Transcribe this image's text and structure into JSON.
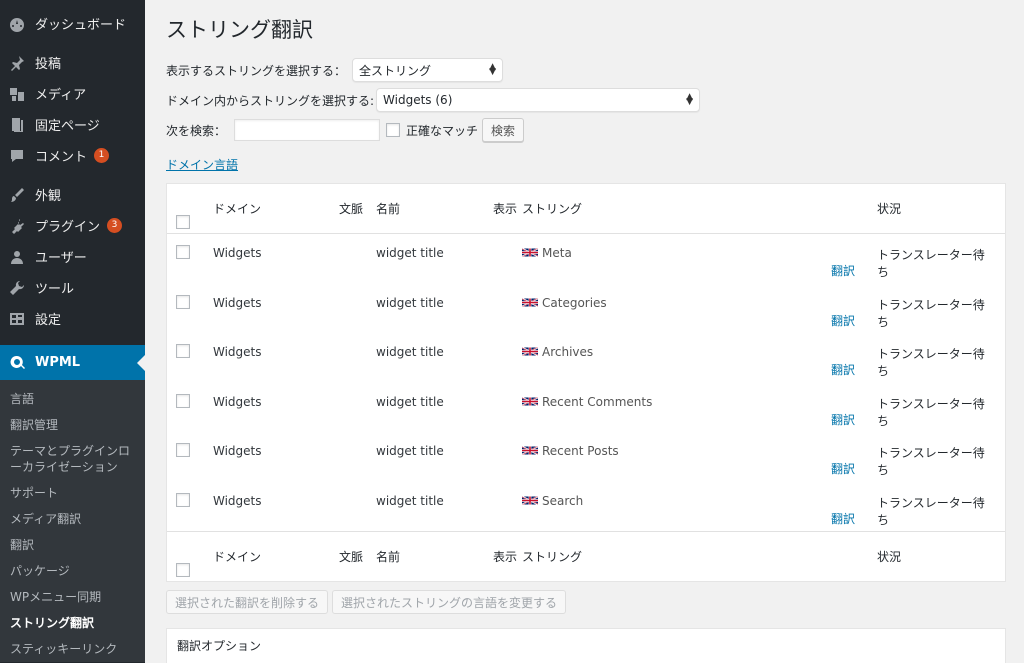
{
  "sidebar": {
    "items": [
      {
        "label": "ダッシュボード",
        "icon": "dashboard-icon"
      },
      {
        "label": "投稿",
        "icon": "pin-icon"
      },
      {
        "label": "メディア",
        "icon": "media-icon"
      },
      {
        "label": "固定ページ",
        "icon": "page-icon"
      },
      {
        "label": "コメント",
        "icon": "comment-icon",
        "badge": "1"
      },
      {
        "label": "外観",
        "icon": "brush-icon"
      },
      {
        "label": "プラグイン",
        "icon": "plugin-icon",
        "badge": "3"
      },
      {
        "label": "ユーザー",
        "icon": "user-icon"
      },
      {
        "label": "ツール",
        "icon": "wrench-icon"
      },
      {
        "label": "設定",
        "icon": "settings-icon"
      }
    ],
    "active": {
      "label": "WPML",
      "icon": "wpml-icon"
    },
    "submenu": [
      "言語",
      "翻訳管理",
      "テーマとプラグインローカライゼーション",
      "サポート",
      "メディア翻訳",
      "翻訳",
      "パッケージ",
      "WPメニュー同期",
      "ストリング翻訳",
      "スティッキーリンク"
    ],
    "submenu_current": "ストリング翻訳"
  },
  "page": {
    "title": "ストリング翻訳",
    "filter1_label": "表示するストリングを選択する：",
    "filter1_value": "全ストリング",
    "filter2_label": "ドメイン内からストリングを選択する:",
    "filter2_value": "Widgets (6)",
    "search_label": "次を検索：",
    "search_value": "",
    "exact_match_label": "正確なマッチ",
    "search_button": "検索",
    "domain_language_link": "ドメイン言語"
  },
  "table": {
    "headers": {
      "domain": "ドメイン",
      "context": "文脈",
      "name": "名前",
      "view": "表示",
      "string": "ストリング",
      "status": "状況"
    },
    "translate_label": "翻訳",
    "rows": [
      {
        "domain": "Widgets",
        "name": "widget title",
        "string": "Meta",
        "status": "トランスレーター待ち"
      },
      {
        "domain": "Widgets",
        "name": "widget title",
        "string": "Categories",
        "status": "トランスレーター待ち"
      },
      {
        "domain": "Widgets",
        "name": "widget title",
        "string": "Archives",
        "status": "トランスレーター待ち"
      },
      {
        "domain": "Widgets",
        "name": "widget title",
        "string": "Recent Comments",
        "status": "トランスレーター待ち"
      },
      {
        "domain": "Widgets",
        "name": "widget title",
        "string": "Recent Posts",
        "status": "トランスレーター待ち"
      },
      {
        "domain": "Widgets",
        "name": "widget title",
        "string": "Search",
        "status": "トランスレーター待ち"
      }
    ]
  },
  "bulk": {
    "delete_button": "選択された翻訳を削除する",
    "change_language_button": "選択されたストリングの言語を変更する"
  },
  "options": {
    "title": "翻訳オプション"
  },
  "colors": {
    "sidebar_bg": "#23282d",
    "active_bg": "#0073aa",
    "link": "#0073aa",
    "badge": "#d54e21"
  }
}
